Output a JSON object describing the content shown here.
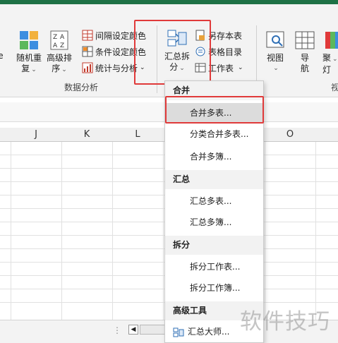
{
  "ribbon": {
    "sort_random": {
      "line1": "随机重",
      "line2": "复"
    },
    "sort_advanced": {
      "line1": "高级排",
      "line2": "序"
    },
    "interval_color": "间隔设定颜色",
    "condition_color": "条件设定颜色",
    "stats_analysis": "统计与分析",
    "group_label": "数据分析",
    "summarize_split": {
      "line1": "汇总拆",
      "line2": "分"
    },
    "save_as_sheet": "另存本表",
    "table_catalog": "表格目录",
    "worksheet": "工作表",
    "view": "视图",
    "navigate": {
      "line1": "导",
      "line2": "航"
    },
    "spotlight": {
      "line1": "聚",
      "line2": "灯"
    },
    "edge_letter": "视"
  },
  "columns": [
    "J",
    "K",
    "L",
    "O"
  ],
  "dropdown": {
    "section_merge": "合并",
    "merge_multi_sheets": "合并多表...",
    "category_merge": "分类合并多表...",
    "merge_multi_books": "合并多簿...",
    "section_summary": "汇总",
    "summary_multi_sheets": "汇总多表...",
    "summary_multi_books": "汇总多簿...",
    "section_split": "拆分",
    "split_sheet": "拆分工作表...",
    "split_book": "拆分工作簿...",
    "section_advanced": "高级工具",
    "summary_master": "汇总大师..."
  },
  "watermark": "软件技巧",
  "colors": {
    "highlight_red": "#e03a3a",
    "excel_green": "#1e7145"
  }
}
